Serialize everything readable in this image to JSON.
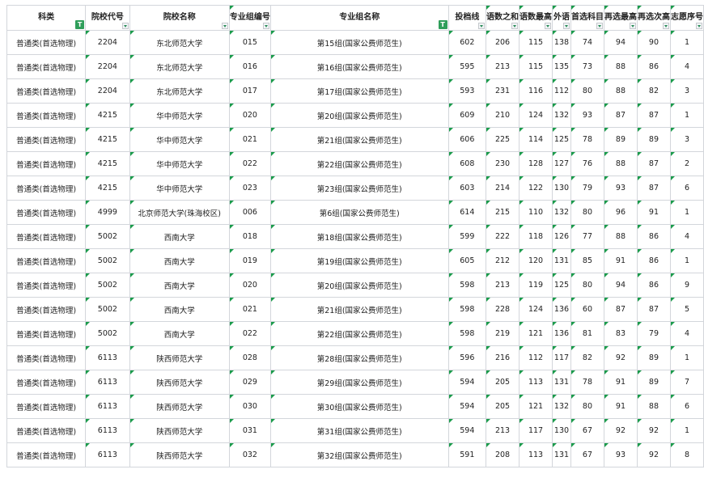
{
  "columns": [
    {
      "label": "科类",
      "filter": "badge"
    },
    {
      "label": "院校代号",
      "filter": "dropdown"
    },
    {
      "label": "院校名称",
      "filter": "dropdown"
    },
    {
      "label": "专业组编号",
      "filter": "dropdown"
    },
    {
      "label": "专业组名称",
      "filter": "badge"
    },
    {
      "label": "投档线",
      "filter": "dropdown"
    },
    {
      "label": "语数之和",
      "filter": "dropdown"
    },
    {
      "label": "语数最高",
      "filter": "dropdown"
    },
    {
      "label": "外语",
      "filter": "dropdown"
    },
    {
      "label": "首选科目",
      "filter": "dropdown"
    },
    {
      "label": "再选最高",
      "filter": "dropdown"
    },
    {
      "label": "再选次高",
      "filter": "dropdown"
    },
    {
      "label": "志愿序号",
      "filter": "dropdown"
    }
  ],
  "badge_text": "T",
  "rows": [
    [
      "普通类(首选物理)",
      "2204",
      "东北师范大学",
      "015",
      "第15组(国家公费师范生)",
      "602",
      "206",
      "115",
      "138",
      "74",
      "94",
      "90",
      "1"
    ],
    [
      "普通类(首选物理)",
      "2204",
      "东北师范大学",
      "016",
      "第16组(国家公费师范生)",
      "595",
      "213",
      "115",
      "135",
      "73",
      "88",
      "86",
      "4"
    ],
    [
      "普通类(首选物理)",
      "2204",
      "东北师范大学",
      "017",
      "第17组(国家公费师范生)",
      "593",
      "231",
      "116",
      "112",
      "80",
      "88",
      "82",
      "3"
    ],
    [
      "普通类(首选物理)",
      "4215",
      "华中师范大学",
      "020",
      "第20组(国家公费师范生)",
      "609",
      "210",
      "124",
      "132",
      "93",
      "87",
      "87",
      "1"
    ],
    [
      "普通类(首选物理)",
      "4215",
      "华中师范大学",
      "021",
      "第21组(国家公费师范生)",
      "606",
      "225",
      "114",
      "125",
      "78",
      "89",
      "89",
      "3"
    ],
    [
      "普通类(首选物理)",
      "4215",
      "华中师范大学",
      "022",
      "第22组(国家公费师范生)",
      "608",
      "230",
      "128",
      "127",
      "76",
      "88",
      "87",
      "2"
    ],
    [
      "普通类(首选物理)",
      "4215",
      "华中师范大学",
      "023",
      "第23组(国家公费师范生)",
      "603",
      "214",
      "122",
      "130",
      "79",
      "93",
      "87",
      "6"
    ],
    [
      "普通类(首选物理)",
      "4999",
      "北京师范大学(珠海校区)",
      "006",
      "第6组(国家公费师范生)",
      "614",
      "215",
      "110",
      "132",
      "80",
      "96",
      "91",
      "1"
    ],
    [
      "普通类(首选物理)",
      "5002",
      "西南大学",
      "018",
      "第18组(国家公费师范生)",
      "599",
      "222",
      "118",
      "126",
      "77",
      "88",
      "86",
      "4"
    ],
    [
      "普通类(首选物理)",
      "5002",
      "西南大学",
      "019",
      "第19组(国家公费师范生)",
      "605",
      "212",
      "120",
      "131",
      "85",
      "91",
      "86",
      "1"
    ],
    [
      "普通类(首选物理)",
      "5002",
      "西南大学",
      "020",
      "第20组(国家公费师范生)",
      "598",
      "213",
      "119",
      "125",
      "80",
      "94",
      "86",
      "9"
    ],
    [
      "普通类(首选物理)",
      "5002",
      "西南大学",
      "021",
      "第21组(国家公费师范生)",
      "598",
      "228",
      "124",
      "136",
      "60",
      "87",
      "87",
      "5"
    ],
    [
      "普通类(首选物理)",
      "5002",
      "西南大学",
      "022",
      "第22组(国家公费师范生)",
      "598",
      "219",
      "121",
      "136",
      "81",
      "83",
      "79",
      "4"
    ],
    [
      "普通类(首选物理)",
      "6113",
      "陕西师范大学",
      "028",
      "第28组(国家公费师范生)",
      "596",
      "216",
      "112",
      "117",
      "82",
      "92",
      "89",
      "1"
    ],
    [
      "普通类(首选物理)",
      "6113",
      "陕西师范大学",
      "029",
      "第29组(国家公费师范生)",
      "594",
      "205",
      "113",
      "131",
      "78",
      "91",
      "89",
      "7"
    ],
    [
      "普通类(首选物理)",
      "6113",
      "陕西师范大学",
      "030",
      "第30组(国家公费师范生)",
      "594",
      "205",
      "121",
      "132",
      "80",
      "91",
      "88",
      "6"
    ],
    [
      "普通类(首选物理)",
      "6113",
      "陕西师范大学",
      "031",
      "第31组(国家公费师范生)",
      "594",
      "213",
      "117",
      "130",
      "67",
      "92",
      "92",
      "1"
    ],
    [
      "普通类(首选物理)",
      "6113",
      "陕西师范大学",
      "032",
      "第32组(国家公费师范生)",
      "591",
      "208",
      "113",
      "131",
      "67",
      "93",
      "92",
      "8"
    ]
  ],
  "colors": {
    "grid": "#d3d6db",
    "marker": "#1a9b4b",
    "badge": "#2f9e5a"
  }
}
